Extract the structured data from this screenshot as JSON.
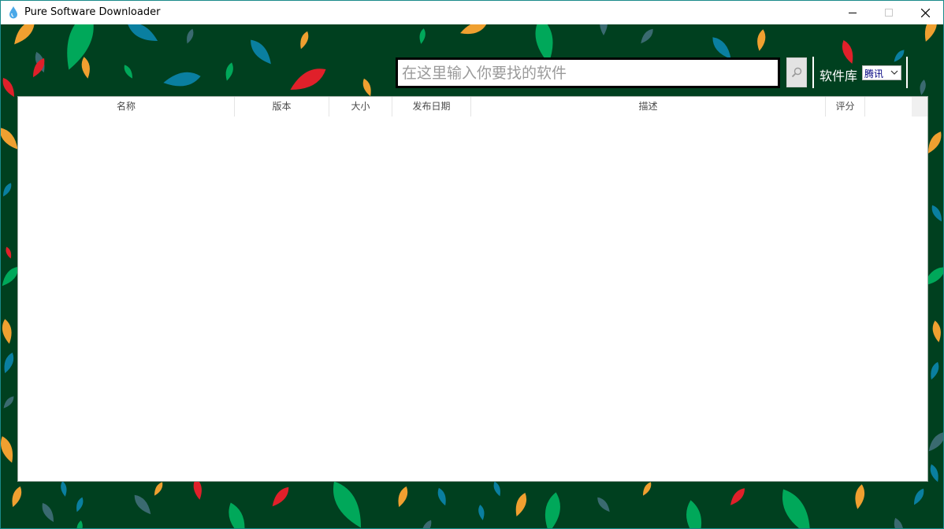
{
  "window": {
    "title": "Pure Software Downloader",
    "icon": "water-drop-icon",
    "controls": [
      "minimize-icon",
      "maximize-icon",
      "close-icon"
    ]
  },
  "search": {
    "placeholder": "在这里输入你要找的软件",
    "value": "",
    "button_icon": "search-icon"
  },
  "library": {
    "label": "软件库",
    "selected": "腾讯"
  },
  "table": {
    "columns": [
      "名称",
      "版本",
      "大小",
      "发布日期",
      "描述",
      "评分"
    ],
    "rows": []
  },
  "colors": {
    "background": "#00401f",
    "leaf_green": "#00a85a",
    "leaf_blue": "#0a7fa0",
    "leaf_orange": "#f0a030",
    "leaf_red": "#e0202a",
    "leaf_slate": "#3a6a70"
  }
}
